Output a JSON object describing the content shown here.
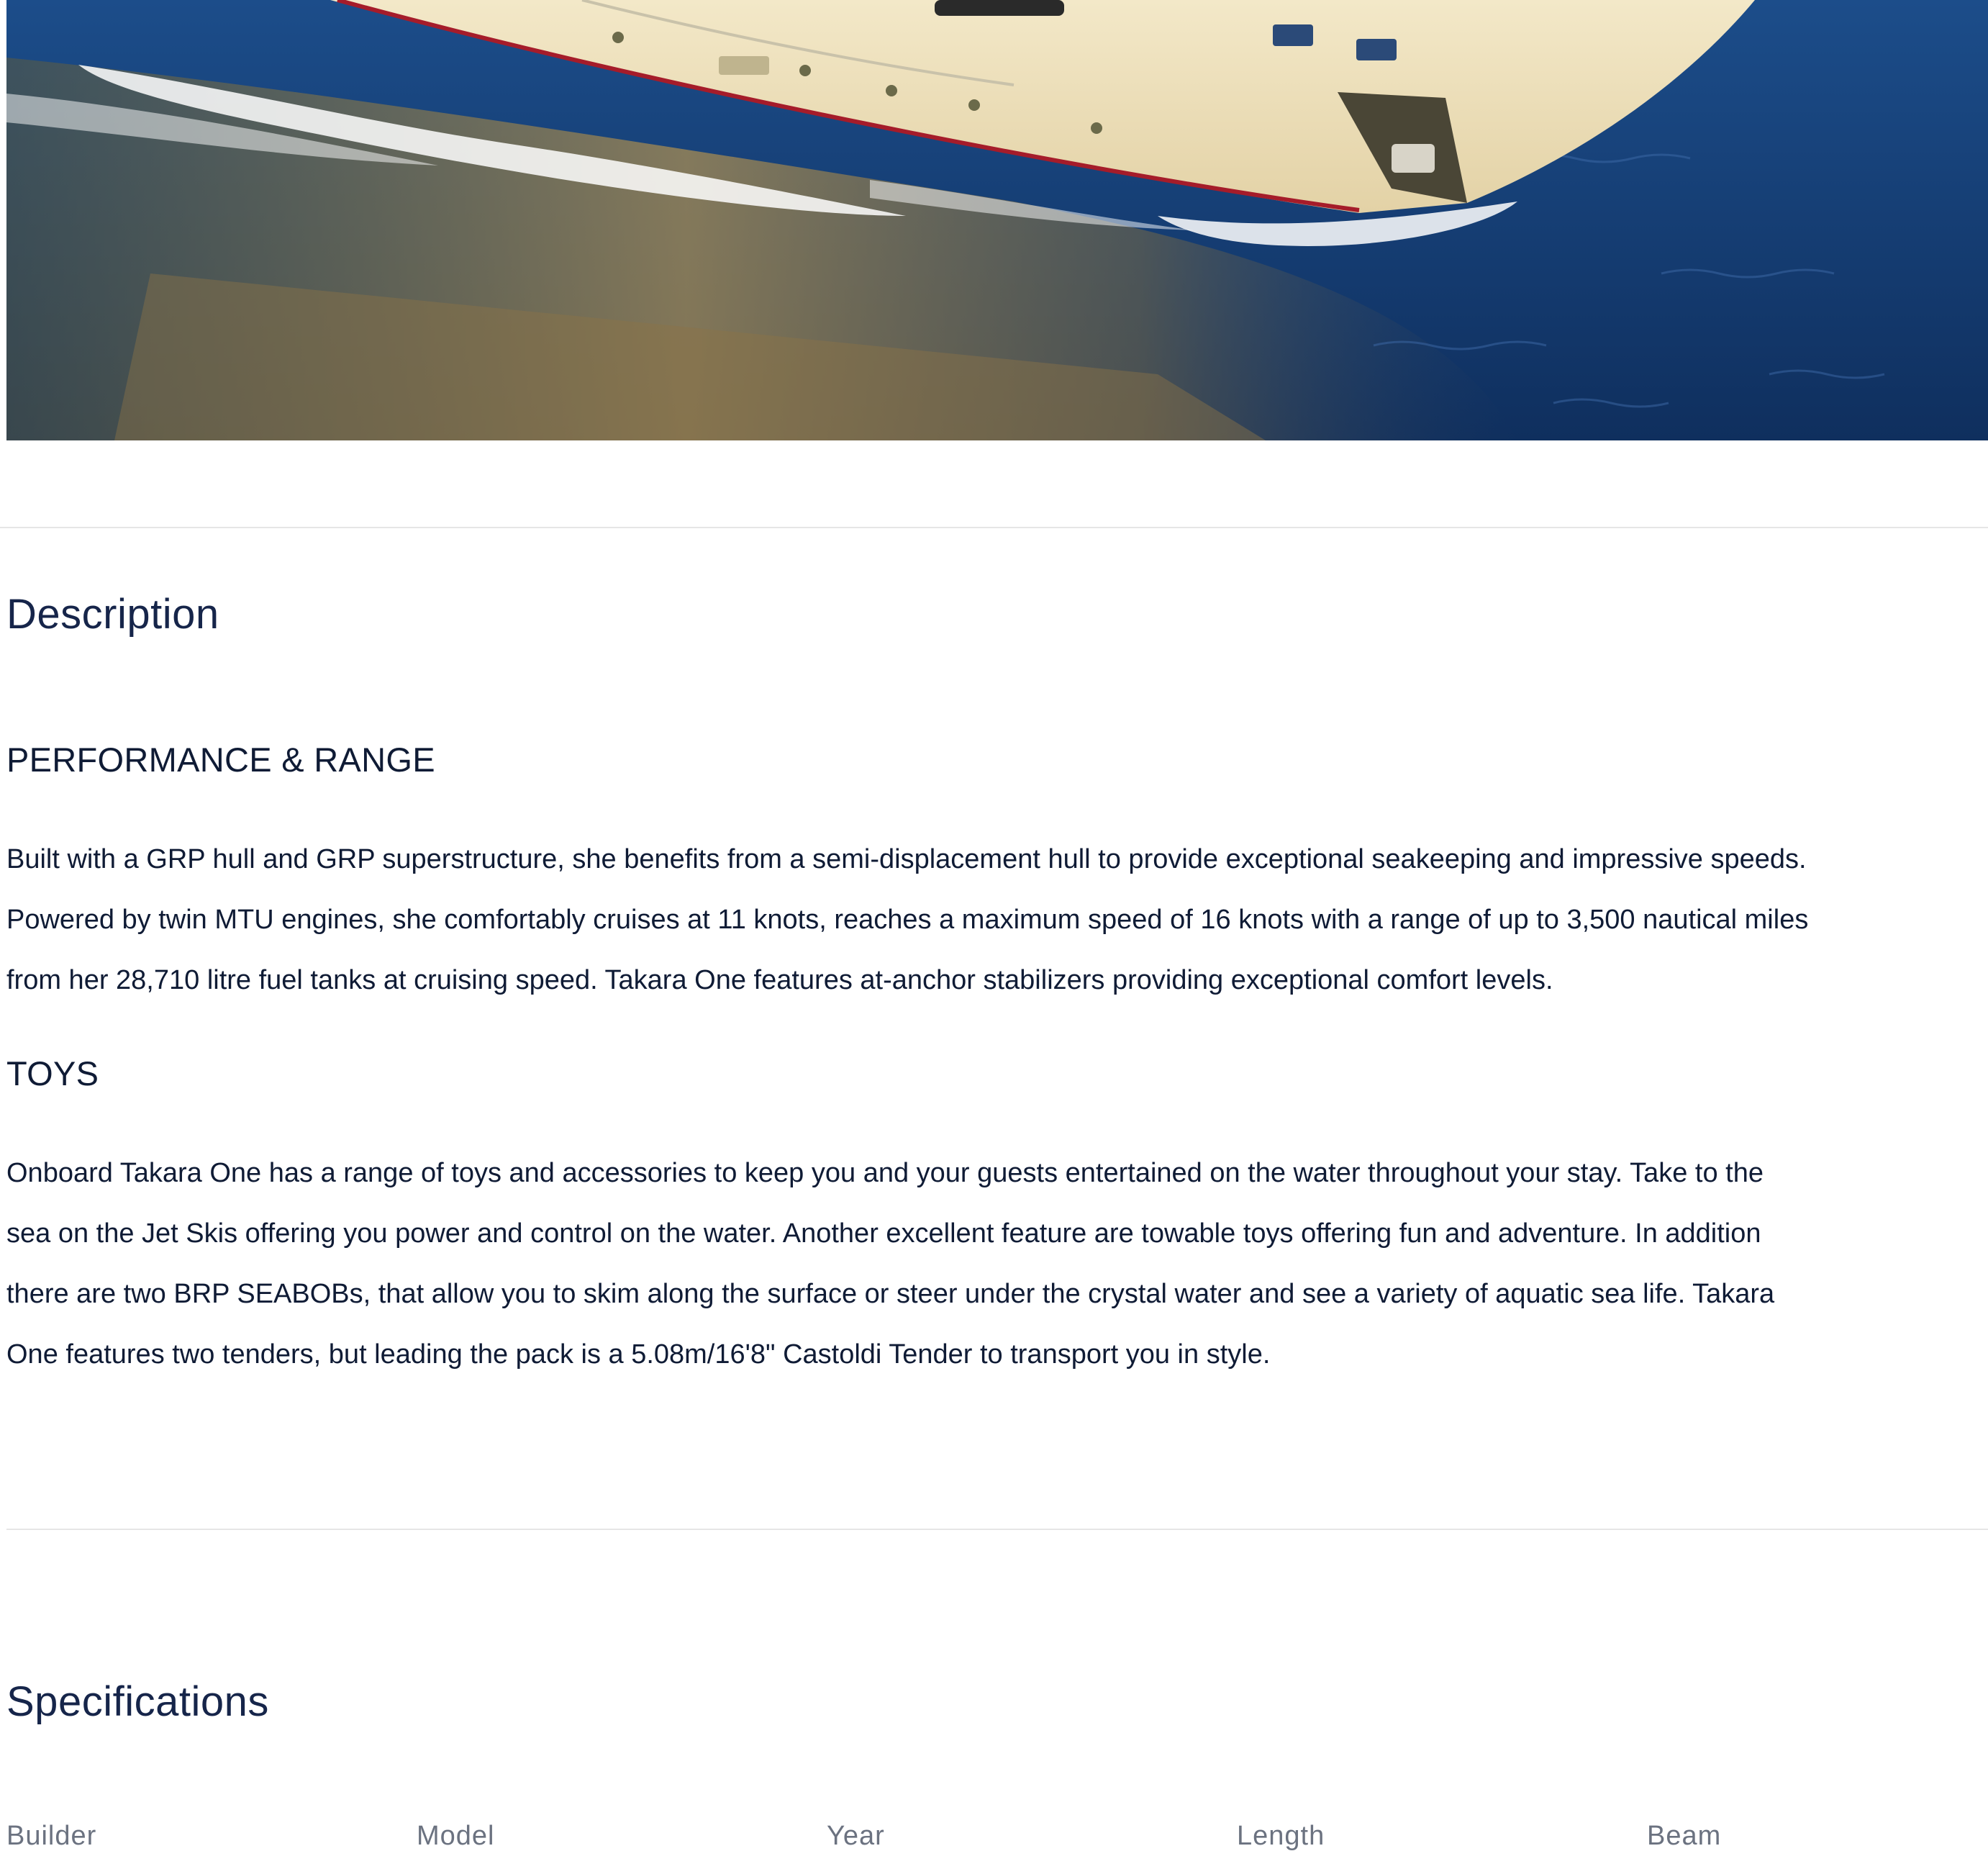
{
  "description": {
    "title": "Description",
    "performance": {
      "heading": "PERFORMANCE & RANGE",
      "lines": [
        "Built with a GRP hull and GRP superstructure, she benefits from a semi-displacement hull to provide exceptional seakeeping and impressive speeds.",
        "Powered by twin MTU engines, she comfortably cruises at 11 knots, reaches a maximum speed of 16 knots with a range of up to 3,500 nautical miles",
        "from her 28,710 litre fuel tanks at cruising speed. Takara One features at-anchor stabilizers providing exceptional comfort levels."
      ]
    },
    "toys": {
      "heading": "TOYS",
      "lines": [
        "Onboard Takara One has a range of toys and accessories to keep you and your guests entertained on the water throughout your stay. Take to the",
        "sea on the Jet Skis offering you power and control on the water. Another excellent feature are towable toys offering fun and adventure. In addition",
        "there are two BRP SEABOBs, that allow you to skim along the surface or steer under the crystal water and see a variety of aquatic sea life. Takara",
        "One features two tenders, but leading the pack is a 5.08m/16'8\" Castoldi Tender to transport you in style."
      ]
    }
  },
  "specifications": {
    "title": "Specifications",
    "labels": [
      "Builder",
      "Model",
      "Year",
      "Length",
      "Beam"
    ]
  },
  "colors": {
    "text_primary": "#0f1b35",
    "text_muted": "#6b7280",
    "divider": "#e6e6e6",
    "sea": "#163f78"
  }
}
